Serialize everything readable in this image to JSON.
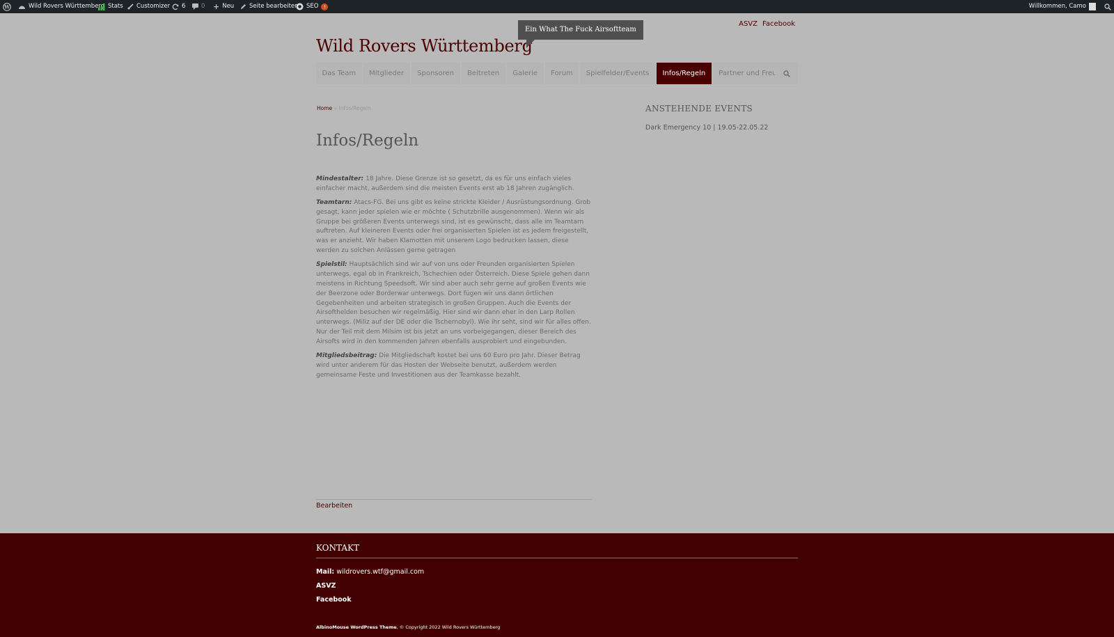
{
  "adminbar": {
    "site_name": "Wild Rovers Württemberg",
    "stats": "Stats",
    "customizer": "Customizer",
    "updates": "6",
    "comments": "0",
    "new": "Neu",
    "edit_page": "Seite bearbeiten",
    "seo": "SEO",
    "seo_badge": "!",
    "welcome": "Willkommen, Camo"
  },
  "header": {
    "links": [
      "ASVZ",
      "Facebook"
    ],
    "site_title": "Wild Rovers Württemberg",
    "tagline": "Ein What The Fuck Airsoftteam"
  },
  "nav": {
    "items": [
      {
        "label": "Das Team"
      },
      {
        "label": "Mitglieder"
      },
      {
        "label": "Sponsoren"
      },
      {
        "label": "Beitreten"
      },
      {
        "label": "Galerie"
      },
      {
        "label": "Forum"
      },
      {
        "label": "Spielfelder/Events"
      },
      {
        "label": "Infos/Regeln",
        "active": true
      },
      {
        "label": "Partner und Freunde"
      }
    ]
  },
  "breadcrumb": {
    "home": "Home",
    "separator": "»",
    "current": "Infos/Regeln"
  },
  "page": {
    "title": "Infos/Regeln",
    "paragraphs": [
      {
        "label": "Mindestalter:",
        "text": " 18 Jahre. Diese Grenze ist so gesetzt, da es für uns einfach vieles einfacher macht, außerdem sind die meisten Events erst ab 18 Jahren zugänglich."
      },
      {
        "label": "Teamtarn:",
        "text": " Atacs-FG. Bei uns gibt es keine strickte Kleider / Ausrüstungsordnung. Grob gesagt, kann jeder spielen wie er möchte ( Schutzbrille ausgenommen).  Wenn wir als Gruppe bei größeren Events unterwegs sind, ist es gewünscht, dass alle im Teamtarn auftreten. Auf kleineren Events oder frei organisierten Spielen ist es jedem freigestellt, was er anzieht. Wir haben Klamotten mit unserem Logo bedrucken lassen, diese werden zu solchen Anlässen gerne getragen"
      },
      {
        "label": "Spielstil:",
        "text": " Hauptsächlich sind wir auf von uns oder Freunden organisierten Spielen unterwegs, egal ob in Frankreich, Tschechien oder Österreich. Diese Spiele gehen dann meistens in Richtung Speedsoft. Wir sind aber auch sehr gerne auf großen Events wie der Beerzone oder Borderwar unterwegs. Dort fügen wir uns dann örtlichen Gegebenheiten und arbeiten strategisch in großen Gruppen. Auch die Events der Airsofthelden besuchen wir regelmäßig. Hier sind wir dann eher in den Larp Rollen unterwegs. (Miliz auf der DE oder die Tschernobyl). Wie ihr seht, sind wir für alles offen. Nur der Teil mit dem Milsim ist bis jetzt an uns vorbeigegangen, dieser Bereich des Airsofts wird in den kommenden Jahren ebenfalls ausprobiert und eingebunden."
      },
      {
        "label": "Mitgliedsbeitrag:",
        "text": " Die Mitgliedschaft kostet bei uns 60 Euro pro Jahr. Dieser Betrag wird unter anderem für das Hosten der Webseite benutzt, außerdem werden gemeinsame Feste und Investitionen aus der Teamkasse bezahlt."
      }
    ],
    "edit_link": "Bearbeiten"
  },
  "sidebar": {
    "widget_title": "ANSTEHENDE EVENTS",
    "event": "Dark Emergency 10 | 19.05-22.05.22"
  },
  "footer": {
    "title": "KONTAKT",
    "mail_label": "Mail:",
    "mail_value": " wildrovers.wtf@gmail.com",
    "asvz": "ASVZ",
    "facebook": "Facebook",
    "credit_bold": "AlbinoMouse WordPress Theme",
    "credit_rest": ", © Copyright 2022 Wild Rovers Württemberg"
  },
  "colors": {
    "brand": "#4a0000",
    "page_bg": "#b9b9b9",
    "adminbar_bg": "#1d2327"
  }
}
